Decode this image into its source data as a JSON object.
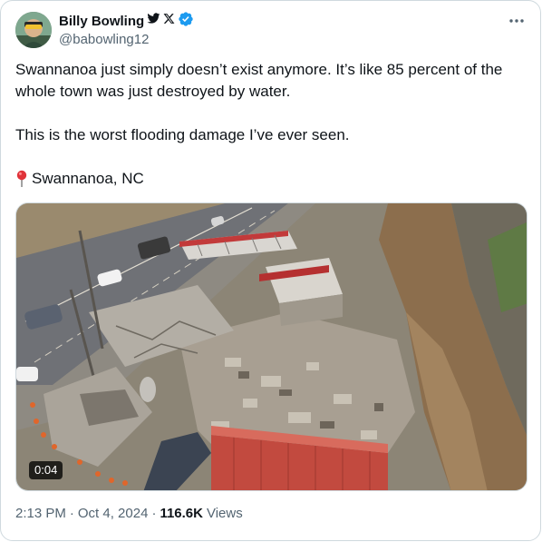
{
  "author": {
    "display_name": "Billy Bowling",
    "handle": "@babowling12",
    "badge_icons": [
      "twitter-bird-icon",
      "x-logo-icon",
      "verified-badge-icon"
    ],
    "verified_color": "#1d9bf0"
  },
  "more_icon": "ellipsis-icon",
  "tweet": {
    "paragraph_1": "Swannanoa just simply doesn’t exist anymore. It’s like 85 percent of the whole town was just destroyed by water.",
    "paragraph_2": "This is the worst flooding damage I’ve ever seen.",
    "location_icon": "round-pushpin-icon",
    "location": "Swannanoa, NC"
  },
  "media": {
    "type": "video",
    "duration": "0:04"
  },
  "meta": {
    "time": "2:13 PM",
    "separator": "·",
    "date": "Oct 4, 2024",
    "views_count": "116.6K",
    "views_label": "Views"
  }
}
